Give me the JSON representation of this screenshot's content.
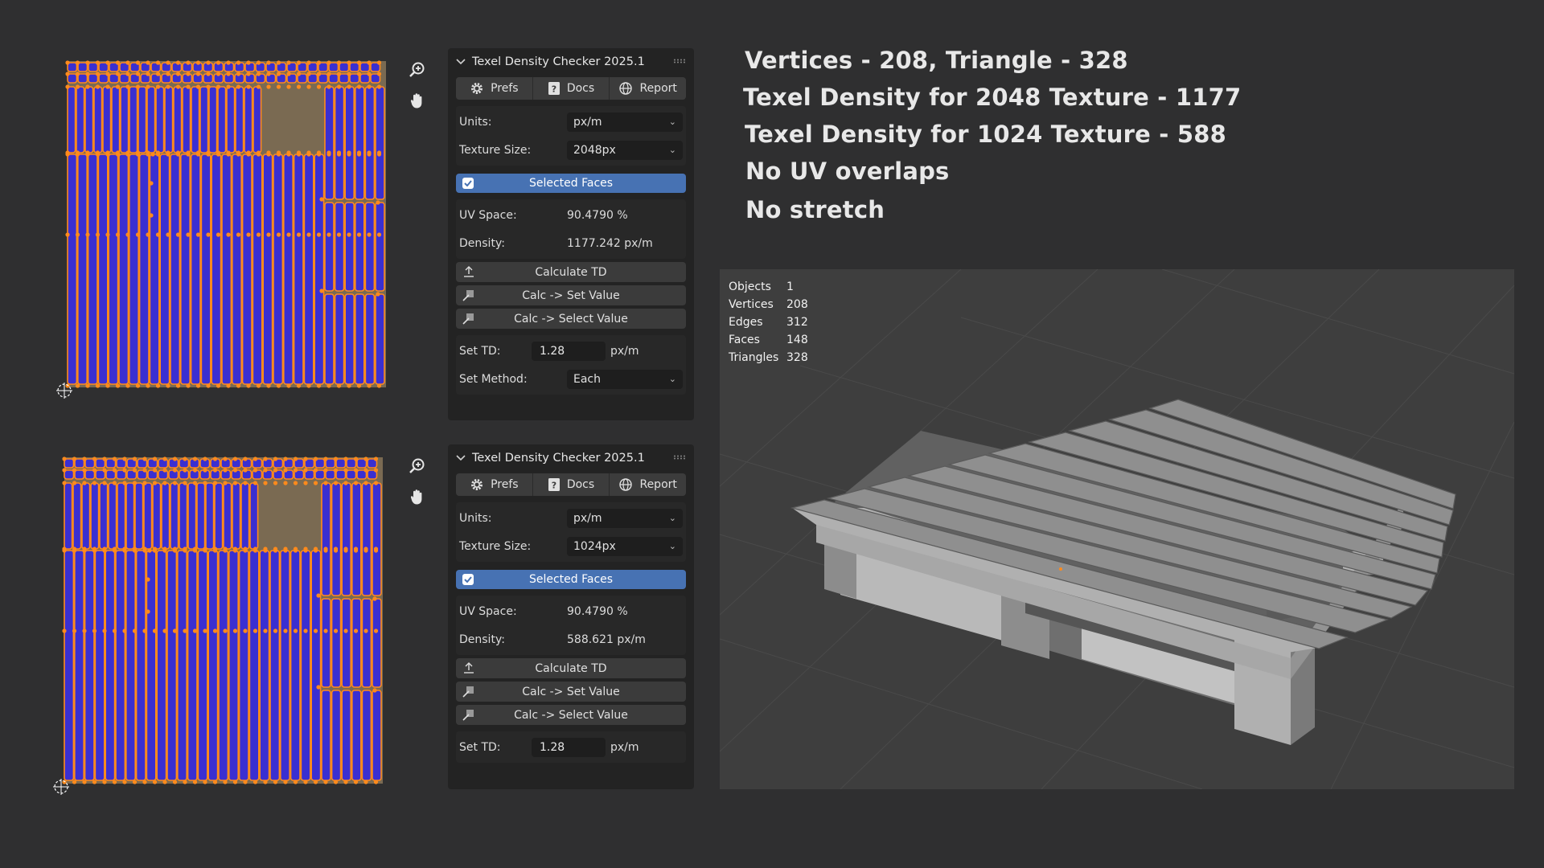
{
  "panels": [
    {
      "title": "Texel Density Checker 2025.1",
      "buttons": {
        "prefs": "Prefs",
        "docs": "Docs",
        "report": "Report"
      },
      "units_label": "Units:",
      "units_value": "px/m",
      "texture_label": "Texture Size:",
      "texture_value": "2048px",
      "selected_faces": "Selected Faces",
      "uv_space_label": "UV Space:",
      "uv_space_value": "90.4790 %",
      "density_label": "Density:",
      "density_value": "1177.242 px/m",
      "calc_td": "Calculate TD",
      "calc_set": "Calc -> Set Value",
      "calc_select": "Calc -> Select Value",
      "set_td_label": "Set TD:",
      "set_td_value": "1.28",
      "set_td_unit": "px/m",
      "set_method_label": "Set Method:",
      "set_method_value": "Each"
    },
    {
      "title": "Texel Density Checker 2025.1",
      "buttons": {
        "prefs": "Prefs",
        "docs": "Docs",
        "report": "Report"
      },
      "units_label": "Units:",
      "units_value": "px/m",
      "texture_label": "Texture Size:",
      "texture_value": "1024px",
      "selected_faces": "Selected Faces",
      "uv_space_label": "UV Space:",
      "uv_space_value": "90.4790 %",
      "density_label": "Density:",
      "density_value": "588.621 px/m",
      "calc_td": "Calculate TD",
      "calc_set": "Calc -> Set Value",
      "calc_select": "Calc -> Select Value",
      "set_td_label": "Set TD:",
      "set_td_value": "1.28",
      "set_td_unit": "px/m"
    }
  ],
  "headlines": [
    "Vertices - 208, Triangle - 328",
    "Texel Density for 2048 Texture - 1177",
    "Texel Density for 1024 Texture - 588",
    "No UV overlaps",
    "No stretch"
  ],
  "stats": [
    {
      "name": "Objects",
      "value": "1"
    },
    {
      "name": "Vertices",
      "value": "208"
    },
    {
      "name": "Edges",
      "value": "312"
    },
    {
      "name": "Faces",
      "value": "148"
    },
    {
      "name": "Triangles",
      "value": "328"
    }
  ],
  "icons": {
    "zoom": "zoom-in-icon",
    "pan": "hand-pan-icon",
    "prefs": "gear-icon",
    "docs": "help-icon",
    "report": "globe-icon",
    "calc": "upload-icon",
    "set": "pick-icon",
    "collapse": "chevron-down-icon"
  },
  "colors": {
    "uv_fill": "#3a2fd1",
    "uv_edge": "#ff8a1c",
    "background": "#2f2f30",
    "panel": "#232323",
    "selected": "#4772b3",
    "viewport": "#3e3e3e"
  }
}
